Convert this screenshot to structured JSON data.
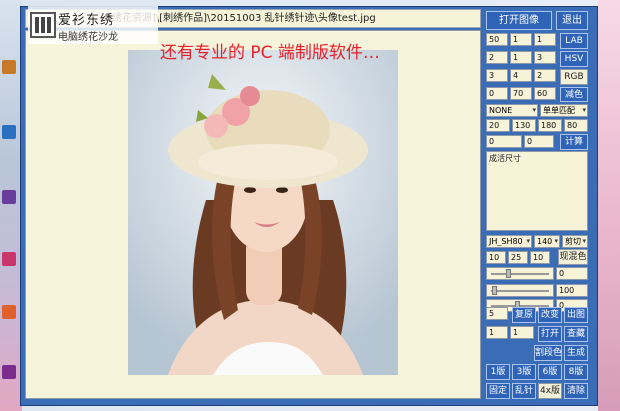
{
  "window": {
    "file_path": "绣花资源]\\[刺绣作品]\\20151003 乱针绣针迹\\头像test.jpg"
  },
  "overlay": {
    "logo_title": "爱衫东绣",
    "logo_subtitle": "电脑绣花沙龙",
    "banner": "还有专业的 PC 端制版软件…"
  },
  "toolbar": {
    "open_image": "打开图像",
    "exit": "退出",
    "lab": "LAB",
    "hsv": "HSV",
    "rgb": "RGB",
    "reduce_color": "减色",
    "calculate": "计算",
    "finished_size": "成活尺寸",
    "show_color": "现混色",
    "recover": "复原",
    "modify": "改变",
    "output": "出图",
    "open": "打开",
    "save": "查藏",
    "mixed_color": "割段色",
    "generate": "生成",
    "v1": "1版",
    "v3": "3版",
    "v6": "6版",
    "v8": "8版",
    "fixed": "固定",
    "random_stitch": "乱针",
    "zoom": "4x版",
    "clear": "清除"
  },
  "color_grid": [
    [
      "50",
      "1",
      "1"
    ],
    [
      "2",
      "1",
      "3"
    ],
    [
      "3",
      "4",
      "2"
    ],
    [
      "0",
      "70",
      "60"
    ]
  ],
  "selects": {
    "none_value": "NONE",
    "match_value": "单单匹配",
    "font_value": "JH_SH80",
    "size_value": "140",
    "mode_value": "剪切"
  },
  "params_row": [
    "20",
    "130",
    "180",
    "80"
  ],
  "params_row2": [
    "0",
    "0"
  ],
  "stitch_row": [
    "10",
    "25",
    "10"
  ],
  "sliders": [
    {
      "value_text": "0",
      "level": 0.3
    },
    {
      "value_text": "100",
      "level": 0.05
    },
    {
      "value_text": "0",
      "level": 0.45
    }
  ],
  "small_inputs": {
    "a": "5",
    "b": "1",
    "c": "1"
  },
  "colors": {
    "window_blue": "#3b6db6",
    "button_blue": "#2f63b8",
    "field_cream": "#f6f3d9",
    "banner_red": "#e8202a"
  }
}
